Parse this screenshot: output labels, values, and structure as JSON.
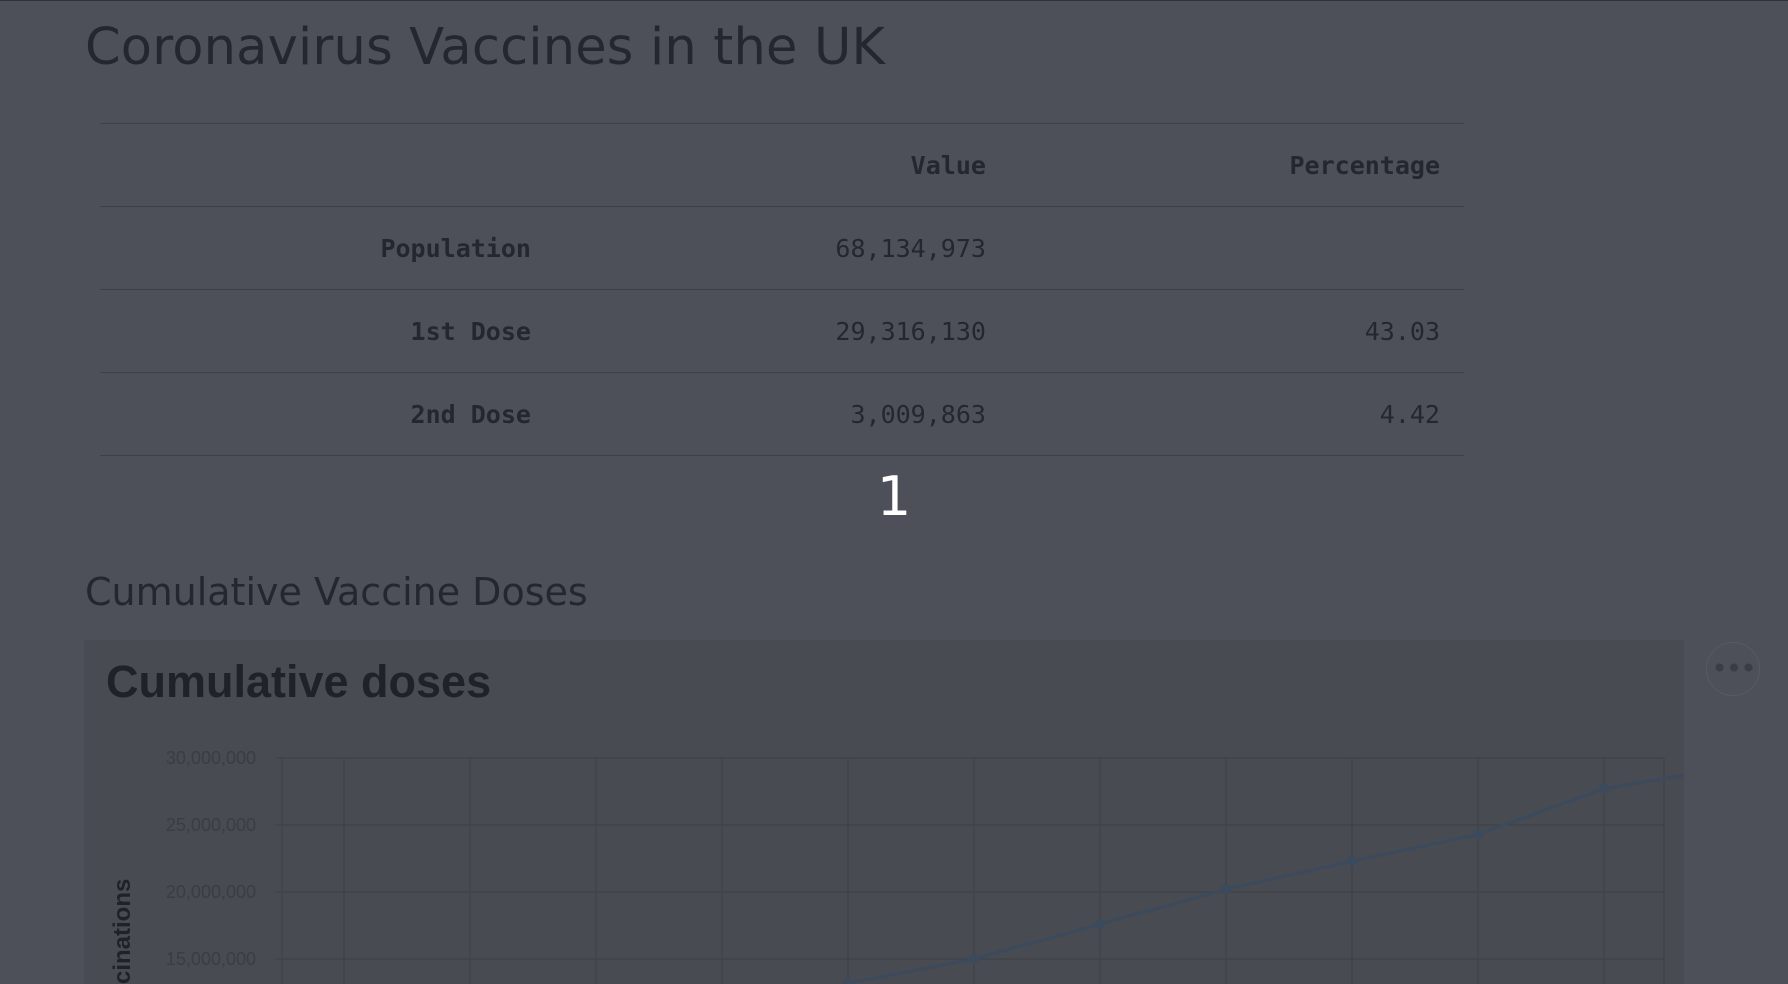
{
  "page": {
    "title": "Coronavirus Vaccines in the UK",
    "table_caption": "1",
    "section_heading": "Cumulative Vaccine Doses",
    "chart_menu_icon": "ellipsis-icon"
  },
  "summary_table": {
    "headers": [
      "",
      "Value",
      "Percentage"
    ],
    "rows": [
      {
        "label": "Population",
        "value": "68,134,973",
        "percentage": ""
      },
      {
        "label": "1st Dose",
        "value": "29,316,130",
        "percentage": "43.03"
      },
      {
        "label": "2nd Dose",
        "value": "3,009,863",
        "percentage": "4.42"
      }
    ]
  },
  "chart_data": {
    "type": "line",
    "title": "Cumulative doses",
    "ylabel": "Vaccinations",
    "ylabel_visible_text": "cinations",
    "ylim": [
      15000000,
      30000000
    ],
    "y_ticks": [
      "30,000,000",
      "25,000,000",
      "20,000,000",
      "15,000,000"
    ],
    "x_gridlines": 12,
    "grid": true,
    "series": [
      {
        "color": "#3b4a5c",
        "x_index": [
          4,
          5,
          6,
          7,
          8,
          9,
          10,
          11
        ],
        "values": [
          13200000,
          15000000,
          17600000,
          20200000,
          22300000,
          24300000,
          27700000,
          29300000
        ]
      }
    ]
  }
}
